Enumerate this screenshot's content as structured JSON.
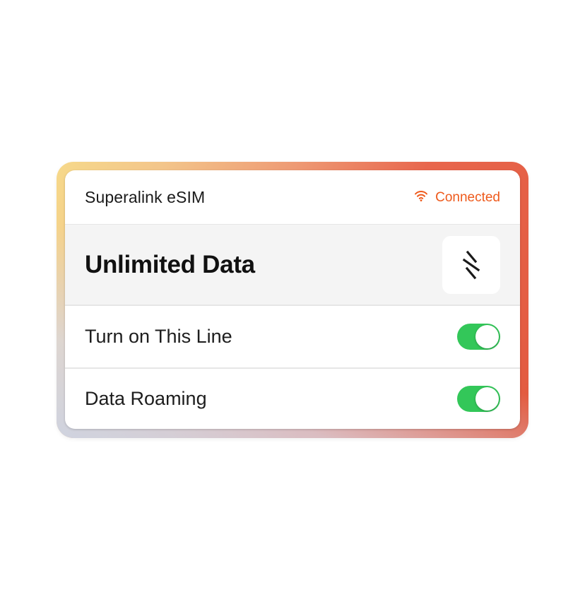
{
  "esim": {
    "provider_name": "Superalink eSIM",
    "status_icon": "wifi-icon",
    "status_text": "Connected",
    "status_color": "#ee5a1c"
  },
  "plan": {
    "name": "Unlimited Data",
    "logo_icon": "superalink-logo-icon"
  },
  "settings": [
    {
      "label": "Turn on This Line",
      "enabled": true
    },
    {
      "label": "Data Roaming",
      "enabled": true
    }
  ],
  "colors": {
    "toggle_on": "#33c759",
    "plan_row_bg": "#f4f4f4",
    "frame_gradient": [
      "#f6d98a",
      "#ee9a74",
      "#e25a3f"
    ]
  }
}
